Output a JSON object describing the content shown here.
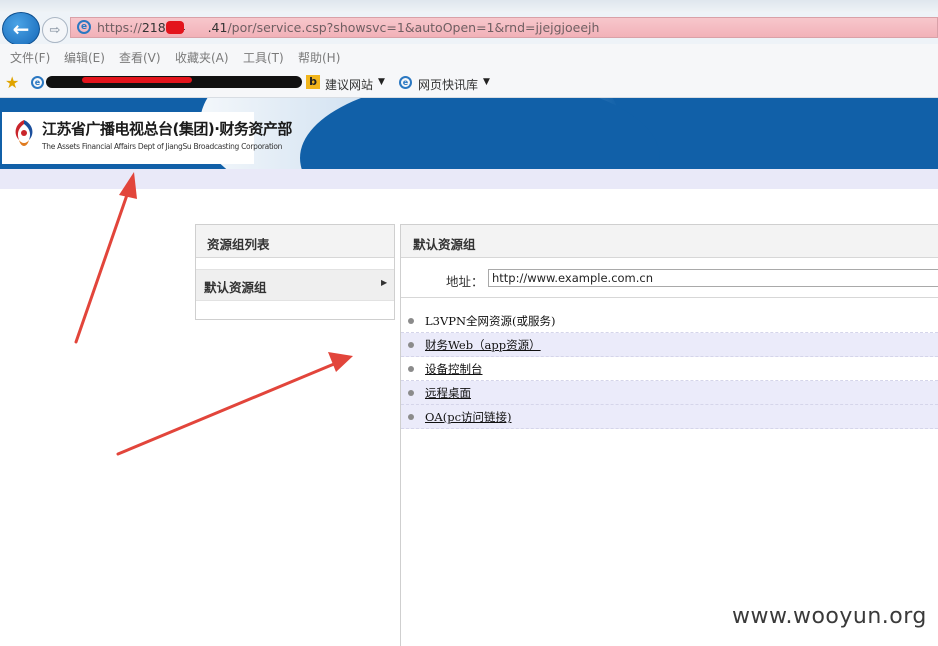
{
  "browser": {
    "url_scheme": "https://",
    "url_host_start": "218.94",
    "url_host_end": ".41",
    "url_path": "/por/service.csp?showsvc=1&autoOpen=1&rnd=jjejgjoeejh",
    "menu": [
      "文件(F)",
      "编辑(E)",
      "查看(V)",
      "收藏夹(A)",
      "工具(T)",
      "帮助(H)"
    ],
    "favorites": {
      "item1": "建议网站",
      "item2": "网页快讯库"
    }
  },
  "banner": {
    "logo_cn": "江苏省广播电视总台(集团)·财务资产部",
    "logo_en": "The Assets Financial Affairs Dept of JiangSu Broadcasting Corporation"
  },
  "left_panel": {
    "title": "资源组列表",
    "items": [
      "默认资源组"
    ]
  },
  "right_panel": {
    "title": "默认资源组",
    "address_label": "地址：",
    "address_value": "http://www.example.com.cn",
    "resources": [
      "L3VPN全网资源(或服务)",
      "财务Web（app资源）",
      "设备控制台",
      "远程桌面",
      "OA(pc访问链接)"
    ]
  },
  "watermark": "www.wooyun.org",
  "colors": {
    "banner_blue": "#1160a8",
    "annotation_red": "#e2453b",
    "row_alt": "#ebebfa"
  }
}
